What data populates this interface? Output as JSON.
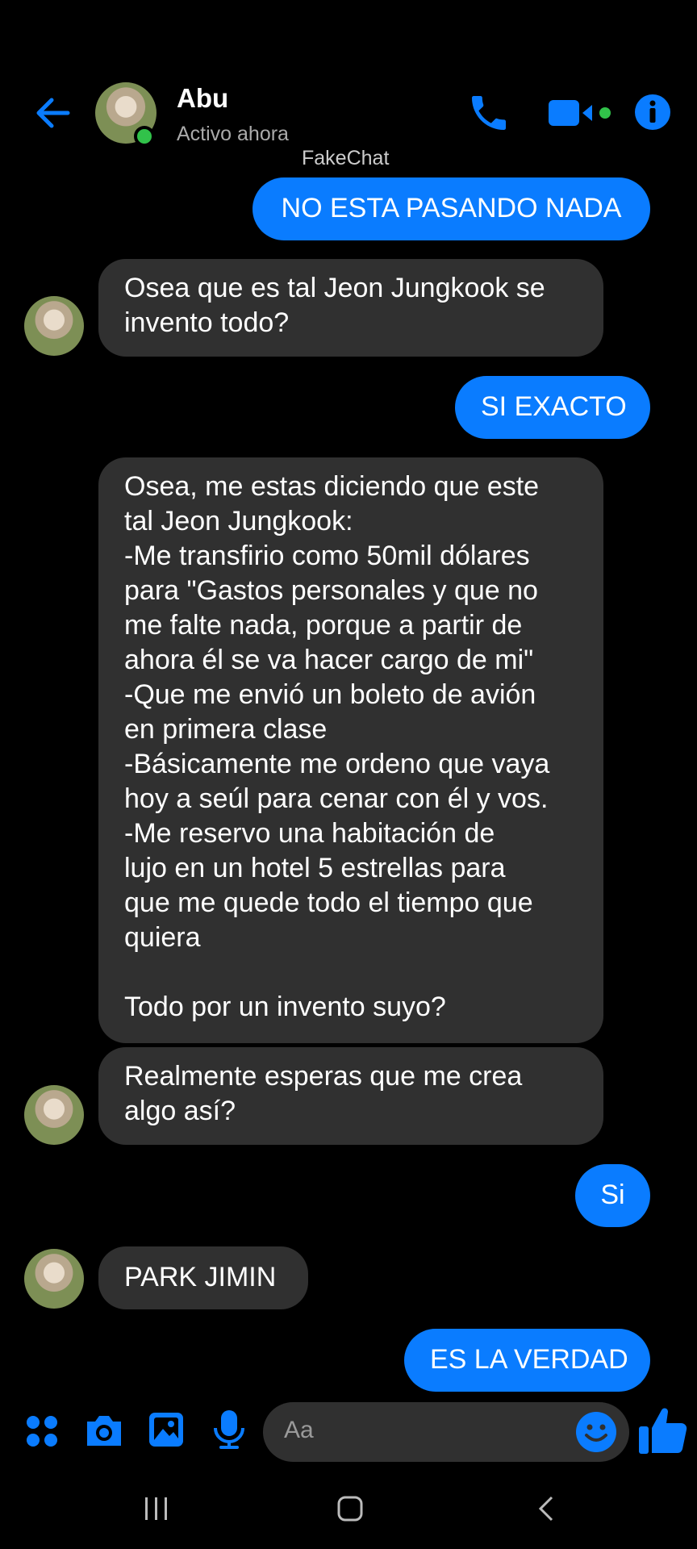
{
  "header": {
    "contact_name": "Abu",
    "status": "Activo ahora",
    "watermark": "FakeChat",
    "accent_color": "#0a7cff",
    "online_color": "#31c24a",
    "icons": [
      "back-arrow-icon",
      "phone-icon",
      "video-camera-icon",
      "info-icon"
    ]
  },
  "messages": [
    {
      "direction": "outgoing",
      "text": "NO ESTA PASANDO NADA"
    },
    {
      "direction": "incoming",
      "text": "Osea que es tal Jeon Jungkook se\ninvento todo?"
    },
    {
      "direction": "outgoing",
      "text": "SI EXACTO"
    },
    {
      "direction": "incoming",
      "text": "Osea, me estas diciendo que este\ntal Jeon Jungkook:\n-Me transfirio como 50mil dólares\npara \"Gastos personales y que no\nme falte nada, porque a partir de\nahora él se va hacer cargo de mi\"\n-Que me envió un boleto de avión\nen primera clase\n-Básicamente me ordeno que vaya\nhoy a seúl para cenar con él y vos.\n-Me reservo una habitación de\nlujo en un hotel 5 estrellas para\nque me quede todo el tiempo que\nquiera\n\nTodo por un invento suyo?"
    },
    {
      "direction": "incoming",
      "text": "Realmente esperas que me crea\nalgo así?"
    },
    {
      "direction": "outgoing",
      "text": "Si"
    },
    {
      "direction": "incoming",
      "text": "PARK JIMIN"
    },
    {
      "direction": "outgoing",
      "text": "ES LA VERDAD"
    }
  ],
  "composer": {
    "placeholder": "Aa",
    "icons": [
      "apps-icon",
      "camera-icon",
      "gallery-icon",
      "microphone-icon",
      "emoji-icon",
      "thumbs-up-icon"
    ]
  },
  "navbar": {
    "icons": [
      "recent-apps-icon",
      "home-icon",
      "back-icon"
    ]
  }
}
